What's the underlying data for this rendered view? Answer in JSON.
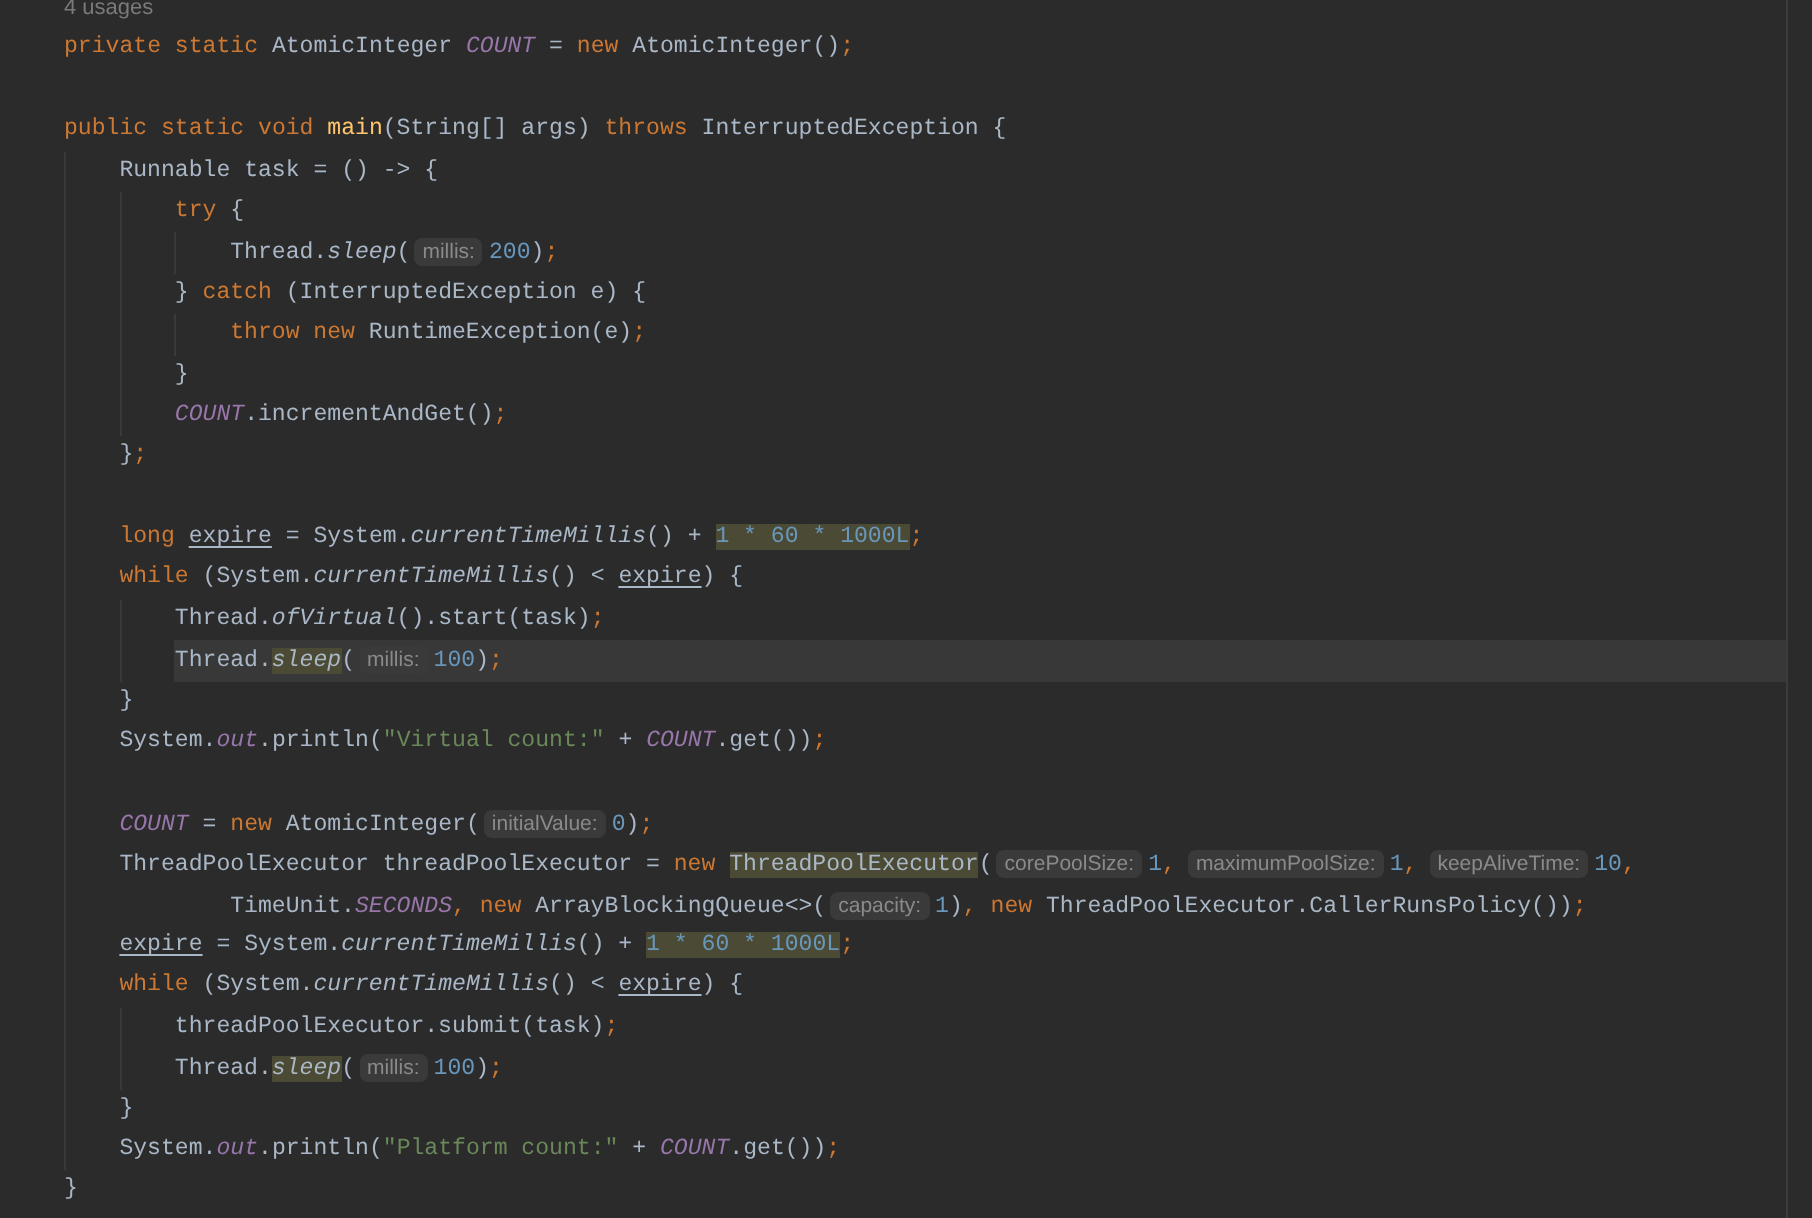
{
  "editor": {
    "lines": [
      {
        "kind": "usages",
        "current": false,
        "text": "4 usages"
      },
      {
        "kind": "code",
        "current": false,
        "tokens": [
          {
            "kind": "kw",
            "t": "private static "
          },
          {
            "kind": "plain",
            "t": "AtomicInteger "
          },
          {
            "kind": "const",
            "t": "COUNT"
          },
          {
            "kind": "plain",
            "t": " = "
          },
          {
            "kind": "kw",
            "t": "new "
          },
          {
            "kind": "plain",
            "t": "AtomicInteger()"
          },
          {
            "kind": "kw",
            "t": ";"
          }
        ]
      },
      {
        "kind": "blank",
        "current": false
      },
      {
        "kind": "code",
        "current": false,
        "tokens": [
          {
            "kind": "kw",
            "t": "public static void "
          },
          {
            "kind": "method",
            "t": "main"
          },
          {
            "kind": "plain",
            "t": "(String[] args) "
          },
          {
            "kind": "kw",
            "t": "throws "
          },
          {
            "kind": "plain",
            "t": "InterruptedException {"
          }
        ],
        "children": [
          {
            "kind": "code",
            "current": false,
            "tokens": [
              {
                "kind": "plain",
                "t": "Runnable task = () -> {"
              }
            ],
            "children": [
              {
                "kind": "code",
                "current": false,
                "tokens": [
                  {
                    "kind": "kw",
                    "t": "try"
                  },
                  {
                    "kind": "plain",
                    "t": " {"
                  }
                ],
                "children": [
                  {
                    "kind": "code",
                    "current": false,
                    "tokens": [
                      {
                        "kind": "plain",
                        "t": "Thread."
                      },
                      {
                        "kind": "call",
                        "t": "sleep"
                      },
                      {
                        "kind": "plain",
                        "t": "("
                      },
                      {
                        "kind": "hint",
                        "t": "millis:"
                      },
                      {
                        "kind": "num",
                        "t": "200"
                      },
                      {
                        "kind": "plain",
                        "t": ")"
                      },
                      {
                        "kind": "kw",
                        "t": ";"
                      }
                    ]
                  }
                ]
              },
              {
                "kind": "code",
                "current": false,
                "tokens": [
                  {
                    "kind": "plain",
                    "t": "} "
                  },
                  {
                    "kind": "kw",
                    "t": "catch"
                  },
                  {
                    "kind": "plain",
                    "t": " (InterruptedException e) {"
                  }
                ],
                "children": [
                  {
                    "kind": "code",
                    "current": false,
                    "tokens": [
                      {
                        "kind": "kw",
                        "t": "throw new "
                      },
                      {
                        "kind": "plain",
                        "t": "RuntimeException(e)"
                      },
                      {
                        "kind": "kw",
                        "t": ";"
                      }
                    ]
                  }
                ]
              },
              {
                "kind": "code",
                "current": false,
                "tokens": [
                  {
                    "kind": "plain",
                    "t": "}"
                  }
                ]
              },
              {
                "kind": "code",
                "current": false,
                "tokens": [
                  {
                    "kind": "const",
                    "t": "COUNT"
                  },
                  {
                    "kind": "plain",
                    "t": ".incrementAndGet()"
                  },
                  {
                    "kind": "kw",
                    "t": ";"
                  }
                ]
              }
            ]
          },
          {
            "kind": "code",
            "current": false,
            "tokens": [
              {
                "kind": "plain",
                "t": "}"
              },
              {
                "kind": "kw",
                "t": ";"
              }
            ]
          },
          {
            "kind": "blank",
            "current": false
          },
          {
            "kind": "code",
            "current": false,
            "tokens": [
              {
                "kind": "kw",
                "t": "long "
              },
              {
                "kind": "var",
                "t": "expire"
              },
              {
                "kind": "plain",
                "t": " = System."
              },
              {
                "kind": "call",
                "t": "currentTimeMillis"
              },
              {
                "kind": "plain",
                "t": "() + "
              },
              {
                "kind": "num_hl",
                "t": "1 * 60 * 1000L"
              },
              {
                "kind": "kw",
                "t": ";"
              }
            ]
          },
          {
            "kind": "code",
            "current": false,
            "tokens": [
              {
                "kind": "kw",
                "t": "while "
              },
              {
                "kind": "plain",
                "t": "(System."
              },
              {
                "kind": "call",
                "t": "currentTimeMillis"
              },
              {
                "kind": "plain",
                "t": "() < "
              },
              {
                "kind": "var",
                "t": "expire"
              },
              {
                "kind": "plain",
                "t": ") {"
              }
            ],
            "children": [
              {
                "kind": "code",
                "current": false,
                "tokens": [
                  {
                    "kind": "plain",
                    "t": "Thread."
                  },
                  {
                    "kind": "call",
                    "t": "ofVirtual"
                  },
                  {
                    "kind": "plain",
                    "t": "().start(task)"
                  },
                  {
                    "kind": "kw",
                    "t": ";"
                  }
                ]
              },
              {
                "kind": "code",
                "current": true,
                "tokens": [
                  {
                    "kind": "plain",
                    "t": "Thread."
                  },
                  {
                    "kind": "call_hl",
                    "t": "sleep"
                  },
                  {
                    "kind": "plain",
                    "t": "("
                  },
                  {
                    "kind": "hint",
                    "t": "millis:"
                  },
                  {
                    "kind": "num",
                    "t": "100"
                  },
                  {
                    "kind": "plain",
                    "t": ")"
                  },
                  {
                    "kind": "kw",
                    "t": ";"
                  }
                ]
              }
            ]
          },
          {
            "kind": "code",
            "current": false,
            "tokens": [
              {
                "kind": "plain",
                "t": "}"
              }
            ]
          },
          {
            "kind": "code",
            "current": false,
            "tokens": [
              {
                "kind": "plain",
                "t": "System."
              },
              {
                "kind": "field",
                "t": "out"
              },
              {
                "kind": "plain",
                "t": ".println("
              },
              {
                "kind": "str",
                "t": "\"Virtual count:\""
              },
              {
                "kind": "plain",
                "t": " + "
              },
              {
                "kind": "const",
                "t": "COUNT"
              },
              {
                "kind": "plain",
                "t": ".get())"
              },
              {
                "kind": "kw",
                "t": ";"
              }
            ]
          },
          {
            "kind": "blank",
            "current": false
          },
          {
            "kind": "code",
            "current": false,
            "tokens": [
              {
                "kind": "const",
                "t": "COUNT"
              },
              {
                "kind": "plain",
                "t": " = "
              },
              {
                "kind": "kw",
                "t": "new "
              },
              {
                "kind": "plain",
                "t": "AtomicInteger("
              },
              {
                "kind": "hint",
                "t": "initialValue:"
              },
              {
                "kind": "num",
                "t": "0"
              },
              {
                "kind": "plain",
                "t": ")"
              },
              {
                "kind": "kw",
                "t": ";"
              }
            ]
          },
          {
            "kind": "code",
            "current": false,
            "tokens": [
              {
                "kind": "plain",
                "t": "ThreadPoolExecutor threadPoolExecutor = "
              },
              {
                "kind": "kw",
                "t": "new "
              },
              {
                "kind": "plain_hl",
                "t": "ThreadPoolExecutor"
              },
              {
                "kind": "plain",
                "t": "("
              },
              {
                "kind": "hint",
                "t": "corePoolSize:"
              },
              {
                "kind": "num",
                "t": "1"
              },
              {
                "kind": "kw",
                "t": ","
              },
              {
                "kind": "hint",
                "t": "maximumPoolSize:"
              },
              {
                "kind": "num",
                "t": "1"
              },
              {
                "kind": "kw",
                "t": ","
              },
              {
                "kind": "hint",
                "t": "keepAliveTime:"
              },
              {
                "kind": "num",
                "t": "10"
              },
              {
                "kind": "kw",
                "t": ","
              }
            ]
          },
          {
            "kind": "continuation",
            "current": false,
            "tokens": [
              {
                "kind": "plain",
                "t": "TimeUnit."
              },
              {
                "kind": "const",
                "t": "SECONDS"
              },
              {
                "kind": "kw",
                "t": ", new "
              },
              {
                "kind": "plain",
                "t": "ArrayBlockingQueue<>("
              },
              {
                "kind": "hint",
                "t": "capacity:"
              },
              {
                "kind": "num",
                "t": "1"
              },
              {
                "kind": "plain",
                "t": ")"
              },
              {
                "kind": "kw",
                "t": ", new "
              },
              {
                "kind": "plain",
                "t": "ThreadPoolExecutor.CallerRunsPolicy())"
              },
              {
                "kind": "kw",
                "t": ";"
              }
            ]
          },
          {
            "kind": "code",
            "current": false,
            "tokens": [
              {
                "kind": "var",
                "t": "expire"
              },
              {
                "kind": "plain",
                "t": " = System."
              },
              {
                "kind": "call",
                "t": "currentTimeMillis"
              },
              {
                "kind": "plain",
                "t": "() + "
              },
              {
                "kind": "num_hl",
                "t": "1 * 60 * 1000L"
              },
              {
                "kind": "kw",
                "t": ";"
              }
            ]
          },
          {
            "kind": "code",
            "current": false,
            "tokens": [
              {
                "kind": "kw",
                "t": "while "
              },
              {
                "kind": "plain",
                "t": "(System."
              },
              {
                "kind": "call",
                "t": "currentTimeMillis"
              },
              {
                "kind": "plain",
                "t": "() < "
              },
              {
                "kind": "var",
                "t": "expire"
              },
              {
                "kind": "plain",
                "t": ") {"
              }
            ],
            "children": [
              {
                "kind": "code",
                "current": false,
                "tokens": [
                  {
                    "kind": "plain",
                    "t": "threadPoolExecutor.submit(task)"
                  },
                  {
                    "kind": "kw",
                    "t": ";"
                  }
                ]
              },
              {
                "kind": "code",
                "current": false,
                "tokens": [
                  {
                    "kind": "plain",
                    "t": "Thread."
                  },
                  {
                    "kind": "call_hl",
                    "t": "sleep"
                  },
                  {
                    "kind": "plain",
                    "t": "("
                  },
                  {
                    "kind": "hint",
                    "t": "millis:"
                  },
                  {
                    "kind": "num",
                    "t": "100"
                  },
                  {
                    "kind": "plain",
                    "t": ")"
                  },
                  {
                    "kind": "kw",
                    "t": ";"
                  }
                ]
              }
            ]
          },
          {
            "kind": "code",
            "current": false,
            "tokens": [
              {
                "kind": "plain",
                "t": "}"
              }
            ]
          },
          {
            "kind": "code",
            "current": false,
            "tokens": [
              {
                "kind": "plain",
                "t": "System."
              },
              {
                "kind": "field",
                "t": "out"
              },
              {
                "kind": "plain",
                "t": ".println("
              },
              {
                "kind": "str",
                "t": "\"Platform count:\""
              },
              {
                "kind": "plain",
                "t": " + "
              },
              {
                "kind": "const",
                "t": "COUNT"
              },
              {
                "kind": "plain",
                "t": ".get())"
              },
              {
                "kind": "kw",
                "t": ";"
              }
            ]
          }
        ]
      },
      {
        "kind": "code",
        "current": false,
        "tokens": [
          {
            "kind": "plain",
            "t": "}"
          }
        ]
      }
    ]
  }
}
